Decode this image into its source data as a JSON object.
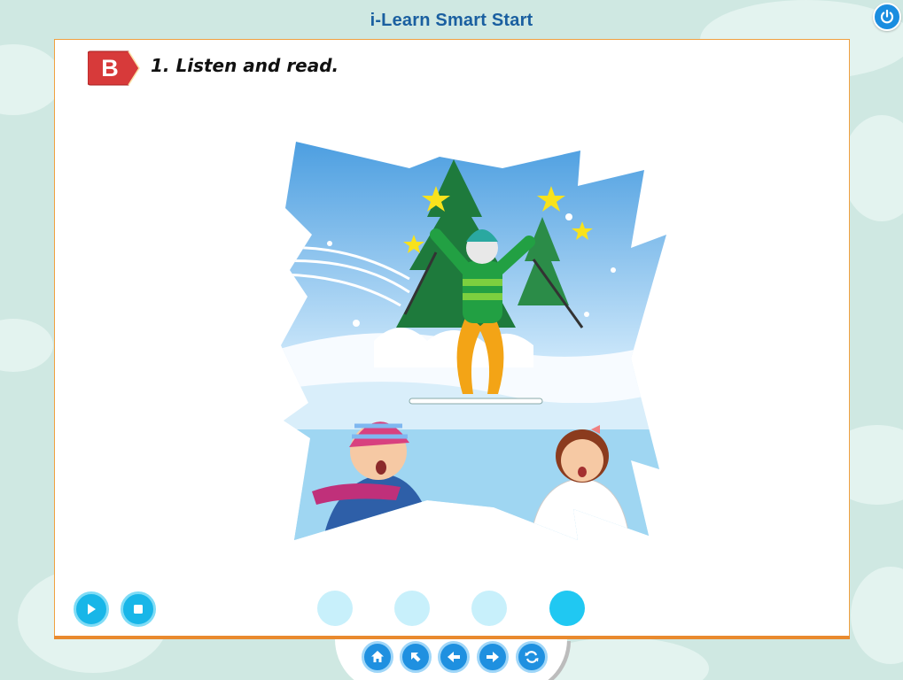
{
  "header": {
    "app_title": "i-Learn Smart Start",
    "power_icon": "power-icon"
  },
  "activity": {
    "section_letter": "B",
    "instruction": "1. Listen and read."
  },
  "illustration": {
    "subject": "children watching a skier jump in the snow"
  },
  "audio_controls": {
    "play_icon": "play-icon",
    "stop_icon": "stop-icon"
  },
  "pager": {
    "dots": 4,
    "active_index": 3
  },
  "nav": {
    "buttons": [
      "home-icon",
      "back-arrow-icon",
      "previous-icon",
      "next-icon",
      "refresh-icon"
    ]
  },
  "colors": {
    "title": "#1a5fa0",
    "accent_blue": "#18b6e8",
    "panel_border": "#e98a2e",
    "badge_red": "#d73a3a"
  }
}
